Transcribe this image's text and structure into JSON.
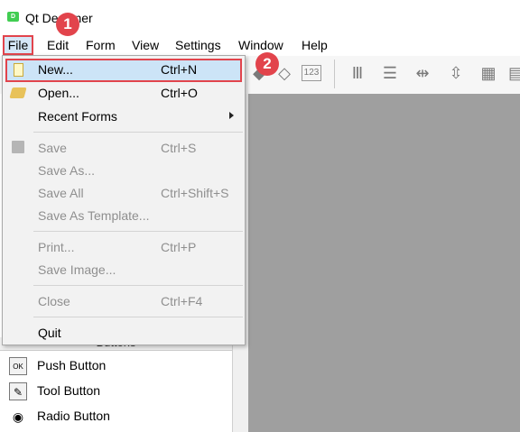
{
  "window": {
    "title": "Qt Designer"
  },
  "menubar": {
    "items": [
      "File",
      "Edit",
      "Form",
      "View",
      "Settings",
      "Window",
      "Help"
    ]
  },
  "file_menu": {
    "items": [
      {
        "label": "New...",
        "shortcut": "Ctrl+N",
        "enabled": true,
        "icon": "new-file-icon"
      },
      {
        "label": "Open...",
        "shortcut": "Ctrl+O",
        "enabled": true,
        "icon": "open-folder-icon"
      },
      {
        "label": "Recent Forms",
        "shortcut": "",
        "enabled": true,
        "submenu": true
      },
      {
        "label": "Save",
        "shortcut": "Ctrl+S",
        "enabled": false,
        "icon": "save-icon"
      },
      {
        "label": "Save As...",
        "shortcut": "",
        "enabled": false
      },
      {
        "label": "Save All",
        "shortcut": "Ctrl+Shift+S",
        "enabled": false
      },
      {
        "label": "Save As Template...",
        "shortcut": "",
        "enabled": false
      },
      {
        "label": "Print...",
        "shortcut": "Ctrl+P",
        "enabled": false
      },
      {
        "label": "Save Image...",
        "shortcut": "",
        "enabled": false
      },
      {
        "label": "Close",
        "shortcut": "Ctrl+F4",
        "enabled": false
      },
      {
        "label": "Quit",
        "shortcut": "",
        "enabled": true
      }
    ]
  },
  "widget_box": {
    "section": "Buttons",
    "items": [
      {
        "label": "Push Button",
        "icon": "push-button-icon",
        "icon_text": "OK"
      },
      {
        "label": "Tool Button",
        "icon": "tool-button-icon",
        "icon_text": ""
      },
      {
        "label": "Radio Button",
        "icon": "radio-button-icon",
        "icon_text": ""
      }
    ]
  },
  "annotations": [
    "1",
    "2"
  ],
  "colors": {
    "highlight_border": "#e2444c",
    "selection": "#cce4f7",
    "workspace": "#9f9f9f"
  }
}
